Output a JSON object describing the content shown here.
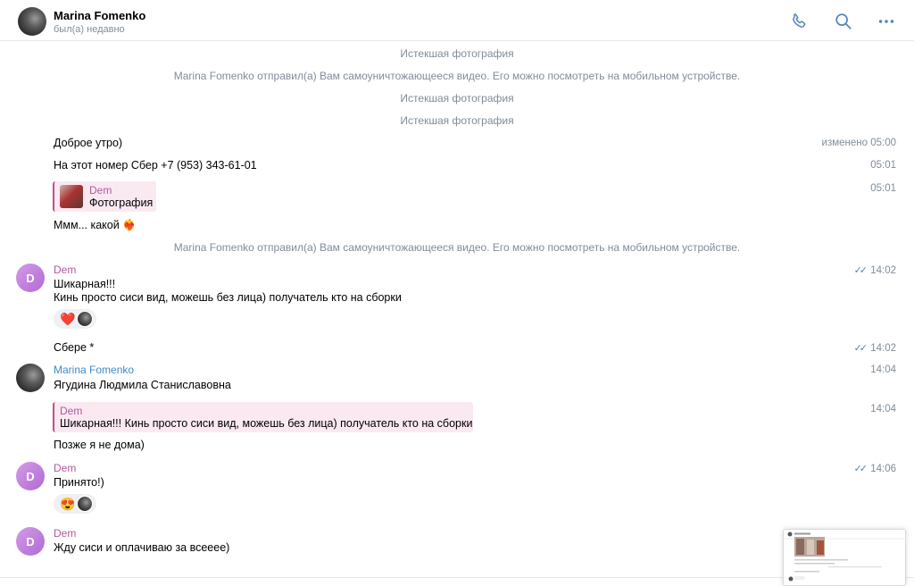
{
  "header": {
    "name": "Marina Fomenko",
    "status": "был(а) недавно",
    "icons": [
      "phone-icon",
      "search-icon",
      "more-icon"
    ],
    "accent": "#5181b8"
  },
  "messages": {
    "sys1": "Истекшая фотография",
    "sys2": "Marina Fomenko отправил(а) Вам самоуничтожающееся видео. Его можно посмотреть на мобильном устройстве.",
    "sys3": "Истекшая фотография",
    "sys4": "Истекшая фотография",
    "m1": {
      "text": "Доброе утро)",
      "time": "изменено 05:00"
    },
    "m2": {
      "text": "На этот номер Сбер +7 (953) 343-61-01",
      "time": "05:01"
    },
    "m3": {
      "reply_name": "Dem",
      "reply_text": "Фотография",
      "time": "05:01"
    },
    "m4": {
      "text": "Ммм... какой ❤️‍🔥"
    },
    "sys5": "Marina Fomenko отправил(а) Вам самоуничтожающееся видео. Его можно посмотреть на мобильном устройстве.",
    "g1": {
      "avatar_letter": "D",
      "sender": "Dem",
      "time": "14:02",
      "line1": "Шикарная!!!",
      "line2": "Кинь просто сиси вид, можешь без лица) получатель кто на сборки",
      "reaction": "❤️"
    },
    "g1b": {
      "text": "Сбере *",
      "time": "14:02"
    },
    "g2": {
      "sender": "Marina Fomenko",
      "time": "14:04",
      "text": "Ягудина Людмила Станиславовна"
    },
    "g2b": {
      "reply_name": "Dem",
      "reply_text": "Шикарная!!! Кинь просто сиси вид, можешь без лица) получатель кто на сборки",
      "time": "14:04"
    },
    "g2c": {
      "text": "Позже я не дома)"
    },
    "g3": {
      "avatar_letter": "D",
      "sender": "Dem",
      "time": "14:06",
      "text": "Принято!)",
      "reaction": "😍"
    },
    "g4": {
      "avatar_letter": "D",
      "sender": "Dem",
      "text": "Жду сиси и оплачиваю за всееее)"
    }
  }
}
